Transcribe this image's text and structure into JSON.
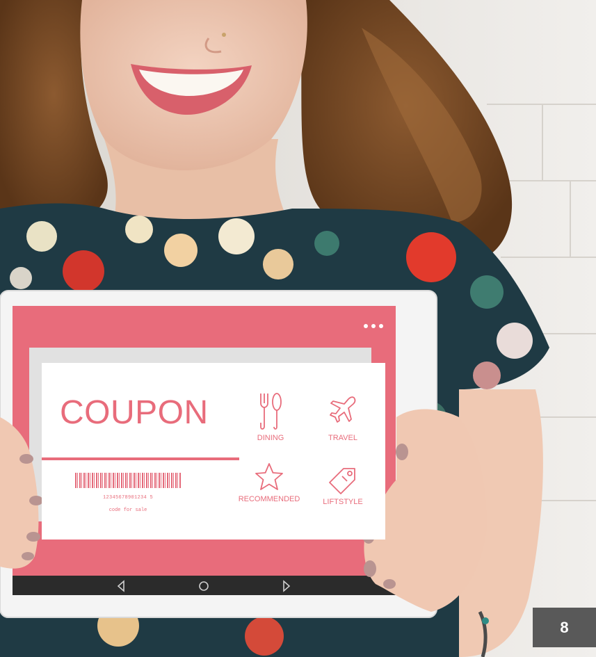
{
  "coupon": {
    "title": "COUPON",
    "barcode_number": "12345678901234 5",
    "barcode_caption": "code for sale",
    "categories": [
      {
        "label": "DINING",
        "icon": "fork-spoon-icon"
      },
      {
        "label": "TRAVEL",
        "icon": "airplane-icon"
      },
      {
        "label": "RECOMMENDED",
        "icon": "star-icon"
      },
      {
        "label": "LIFTSTYLE",
        "icon": "tag-icon"
      }
    ]
  },
  "slide": {
    "page_number": "8"
  },
  "colors": {
    "coupon_pink": "#e86c7b",
    "tablet_frame": "#f4f4f4",
    "nav_bar": "#2b2b2b",
    "badge": "#595959"
  }
}
